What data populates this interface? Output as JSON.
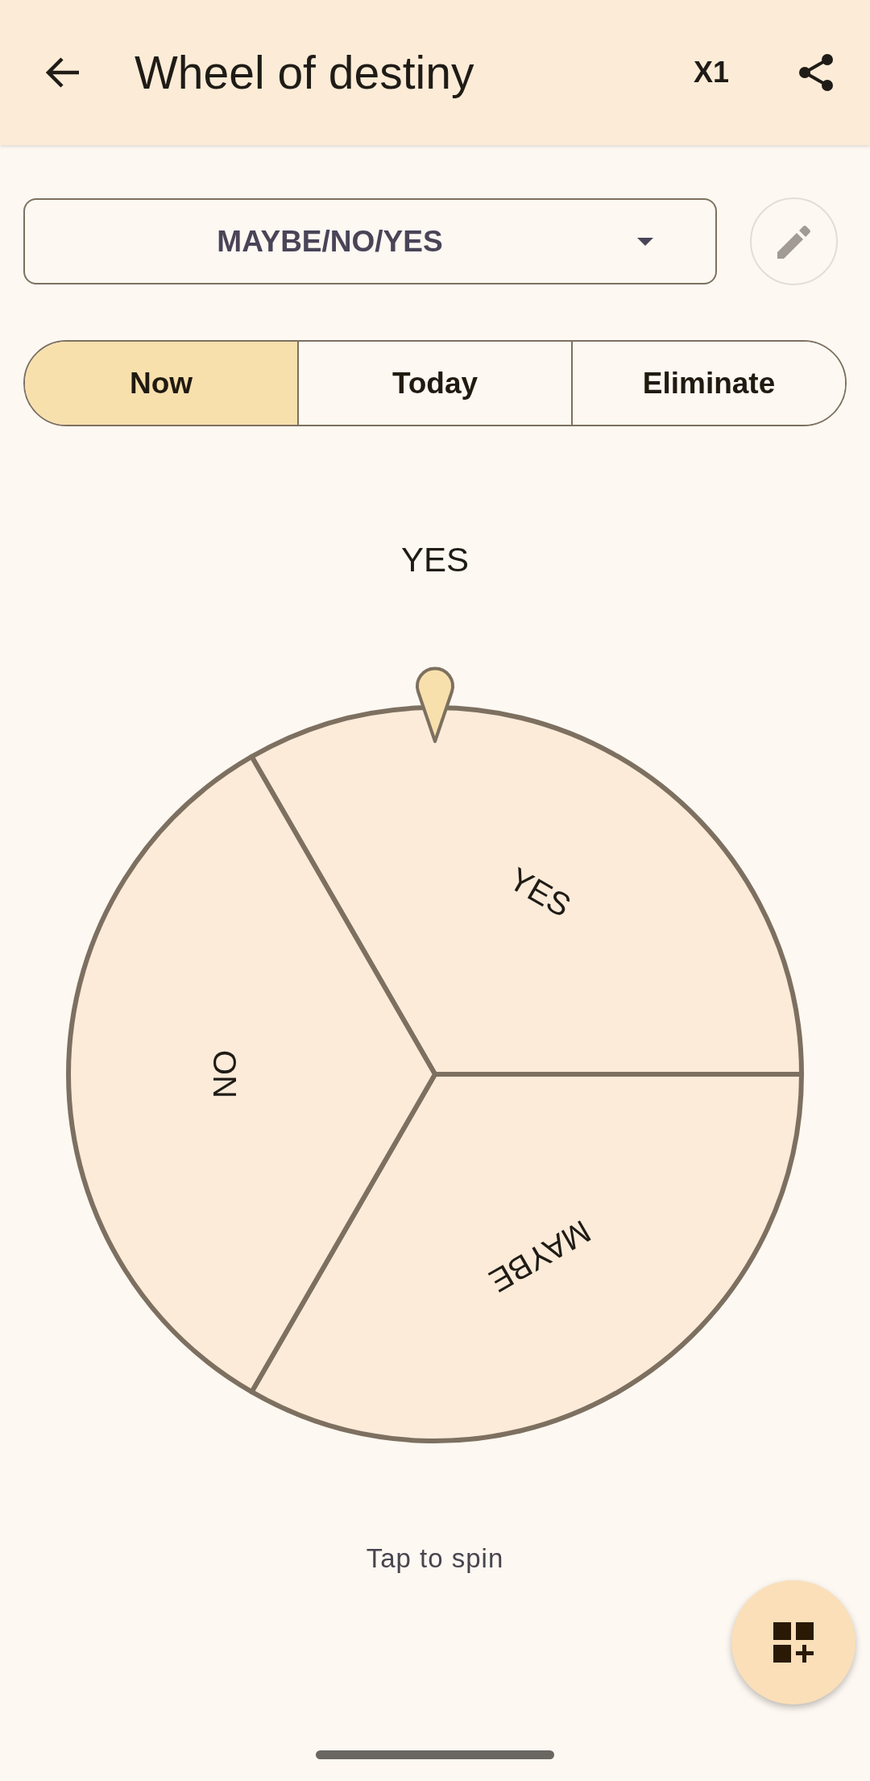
{
  "app_bar": {
    "title": "Wheel of destiny",
    "multiplier": "X1"
  },
  "selector": {
    "value": "MAYBE/NO/YES"
  },
  "modes": [
    {
      "label": "Now",
      "selected": true
    },
    {
      "label": "Today",
      "selected": false
    },
    {
      "label": "Eliminate",
      "selected": false
    }
  ],
  "result": "YES",
  "wheel": {
    "segments": [
      {
        "label": "YES"
      },
      {
        "label": "MAYBE"
      },
      {
        "label": "NO"
      }
    ]
  },
  "hint": "Tap to spin"
}
